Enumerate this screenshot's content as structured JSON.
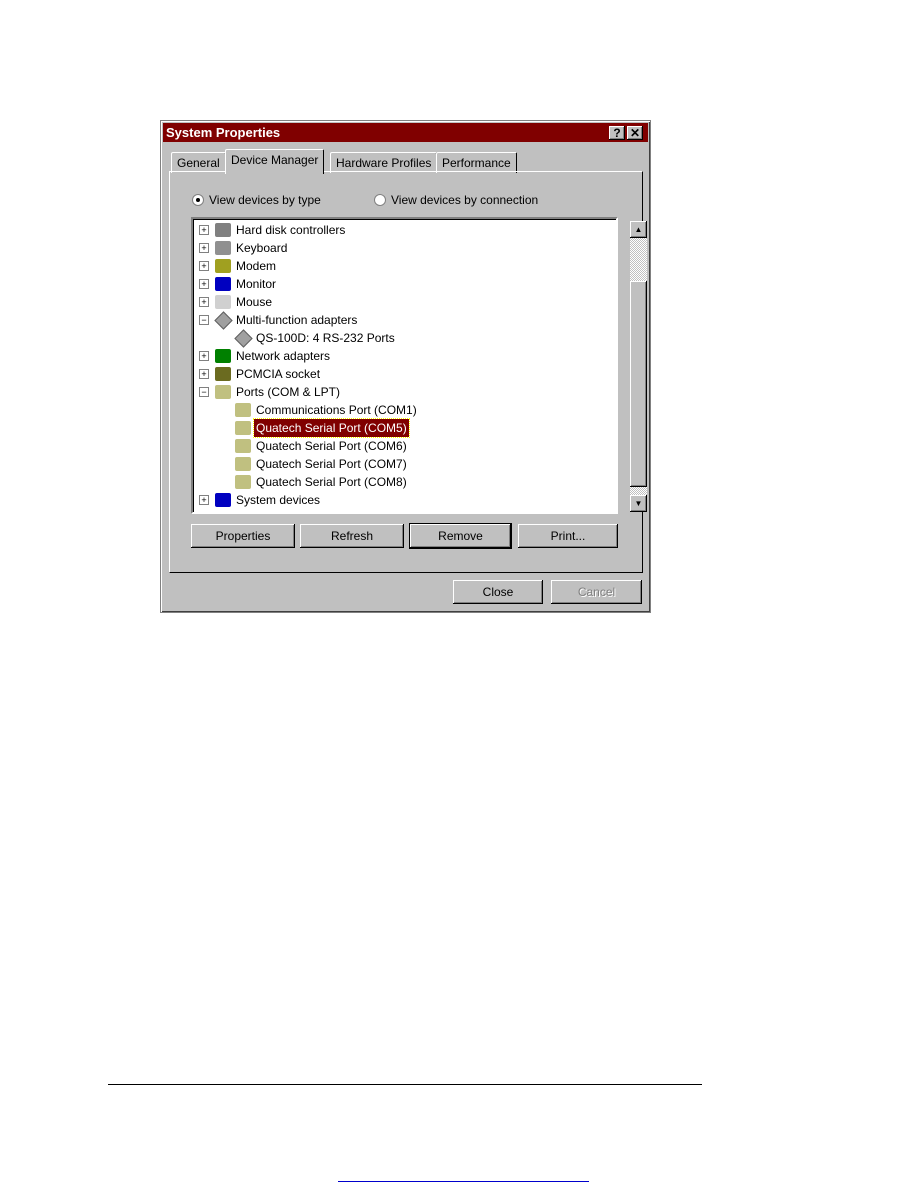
{
  "window": {
    "title": "System Properties",
    "help_label": "?",
    "close_label": "✕"
  },
  "tabs": [
    {
      "label": "General"
    },
    {
      "label": "Device Manager",
      "active": true
    },
    {
      "label": "Hardware Profiles"
    },
    {
      "label": "Performance"
    }
  ],
  "view_options": [
    {
      "label": "View devices by type",
      "selected": true
    },
    {
      "label": "View devices by connection",
      "selected": false
    }
  ],
  "tree": [
    {
      "label": "Hard disk controllers",
      "level": 0,
      "expander": "+",
      "icon": "hard-disk-icon"
    },
    {
      "label": "Keyboard",
      "level": 0,
      "expander": "+",
      "icon": "keyboard-icon"
    },
    {
      "label": "Modem",
      "level": 0,
      "expander": "+",
      "icon": "modem-icon"
    },
    {
      "label": "Monitor",
      "level": 0,
      "expander": "+",
      "icon": "monitor-icon"
    },
    {
      "label": "Mouse",
      "level": 0,
      "expander": "+",
      "icon": "mouse-icon"
    },
    {
      "label": "Multi-function adapters",
      "level": 0,
      "expander": "-",
      "icon": "diamond-icon"
    },
    {
      "label": "QS-100D:  4 RS-232 Ports",
      "level": 1,
      "icon": "diamond-icon"
    },
    {
      "label": "Network adapters",
      "level": 0,
      "expander": "+",
      "icon": "network-card-icon"
    },
    {
      "label": "PCMCIA socket",
      "level": 0,
      "expander": "+",
      "icon": "pcmcia-icon"
    },
    {
      "label": "Ports (COM & LPT)",
      "level": 0,
      "expander": "-",
      "icon": "port-icon"
    },
    {
      "label": "Communications Port (COM1)",
      "level": 1,
      "icon": "port-icon"
    },
    {
      "label": "Quatech Serial Port (COM5)",
      "level": 1,
      "icon": "port-icon",
      "selected": true
    },
    {
      "label": "Quatech Serial Port (COM6)",
      "level": 1,
      "icon": "port-icon"
    },
    {
      "label": "Quatech Serial Port (COM7)",
      "level": 1,
      "icon": "port-icon"
    },
    {
      "label": "Quatech Serial Port (COM8)",
      "level": 1,
      "icon": "port-icon"
    },
    {
      "label": "System devices",
      "level": 0,
      "expander": "+",
      "icon": "computer-icon"
    }
  ],
  "scrollbar": {
    "position_percent": 85
  },
  "buttons": {
    "properties": "Properties",
    "refresh": "Refresh",
    "remove": "Remove",
    "print": "Print...",
    "close": "Close",
    "cancel": "Cancel"
  },
  "colors": {
    "title_bar": "#800000",
    "selection": "#800000",
    "face": "#c0c0c0",
    "link": "#0000cc"
  }
}
